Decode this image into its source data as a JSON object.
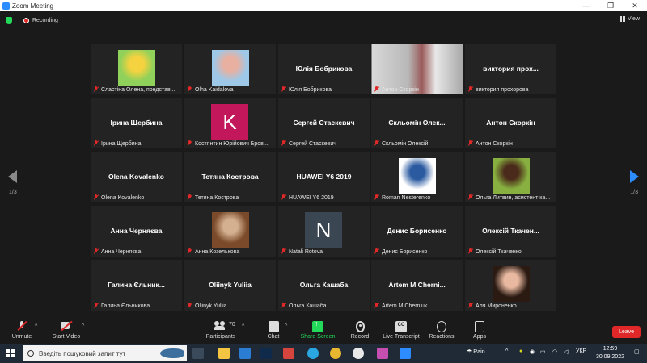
{
  "window": {
    "title": "Zoom Meeting",
    "controls": [
      "—",
      "❐",
      "✕"
    ]
  },
  "topbar": {
    "recording_label": "Recording",
    "view_label": "View"
  },
  "gallery": {
    "page_left": "1/3",
    "page_right": "1/3",
    "tiles": [
      {
        "name": "Сластіна Олена, представ...",
        "big": "",
        "kind": "photo"
      },
      {
        "name": "Olha Kaidalova",
        "big": "",
        "kind": "photo"
      },
      {
        "name": "Юлія Бобрикова",
        "big": "Юлія Бобрикова",
        "kind": "text"
      },
      {
        "name": "Антон Скоркін",
        "big": "",
        "kind": "photo-wide"
      },
      {
        "name": "виктория прохорова",
        "big": "виктория прох...",
        "kind": "text"
      },
      {
        "name": "Ірина Щербина",
        "big": "Ірина Щербина",
        "kind": "text"
      },
      {
        "name": "Костянтин Юрійович Бров...",
        "big": "K",
        "kind": "avatar-k"
      },
      {
        "name": "Сергей Стаскевич",
        "big": "Сергей Стаскевич",
        "kind": "text"
      },
      {
        "name": "Скльомін Олексій",
        "big": "Скльомін Олек...",
        "kind": "text"
      },
      {
        "name": "Антон Скоркін",
        "big": "Антон Скоркін",
        "kind": "text"
      },
      {
        "name": "Olena Kovalenko",
        "big": "Olena Kovalenko",
        "kind": "text"
      },
      {
        "name": "Тетяна Кострова",
        "big": "Тетяна Кострова",
        "kind": "text"
      },
      {
        "name": "HUAWEI Y6 2019",
        "big": "HUAWEI Y6 2019",
        "kind": "text"
      },
      {
        "name": "Roman Nesterenko",
        "big": "",
        "kind": "photo"
      },
      {
        "name": "Ольга Литвин, асистент ка...",
        "big": "",
        "kind": "photo"
      },
      {
        "name": "Анна Черняєва",
        "big": "Анна Черняєва",
        "kind": "text"
      },
      {
        "name": "Анна Козелькова",
        "big": "",
        "kind": "photo"
      },
      {
        "name": "Natali Rotova",
        "big": "N",
        "kind": "avatar-n"
      },
      {
        "name": "Денис Борисенко",
        "big": "Денис Борисенко",
        "kind": "text"
      },
      {
        "name": "Олексій Ткаченко",
        "big": "Олексій Ткачен...",
        "kind": "text"
      },
      {
        "name": "Галина Єльникова",
        "big": "Галина Єльник...",
        "kind": "text"
      },
      {
        "name": "Oliinyk Yuliia",
        "big": "Oliinyk Yuliia",
        "kind": "text"
      },
      {
        "name": "Ольга Кашаба",
        "big": "Ольга Кашаба",
        "kind": "text"
      },
      {
        "name": "Artem M Cherniuk",
        "big": "Artem M Cherni...",
        "kind": "text"
      },
      {
        "name": "Аля Мироненко",
        "big": "",
        "kind": "photo"
      }
    ]
  },
  "toolbar": {
    "unmute": "Unmute",
    "start_video": "Start Video",
    "participants": "Participants",
    "participants_count": "70",
    "chat": "Chat",
    "share_screen": "Share Screen",
    "record": "Record",
    "live_transcript": "Live Transcript",
    "cc": "CC",
    "reactions": "Reactions",
    "apps": "Apps",
    "leave": "Leave"
  },
  "taskbar": {
    "search_placeholder": "Введіть пошуковий запит тут",
    "weather": "Rain...",
    "language": "УКР",
    "time": "12:59",
    "date": "30.09.2022"
  },
  "colors": {
    "accent": "#2d8cff",
    "share_green": "#23d959",
    "leave_red": "#e02828",
    "tile_bg": "#232323"
  }
}
